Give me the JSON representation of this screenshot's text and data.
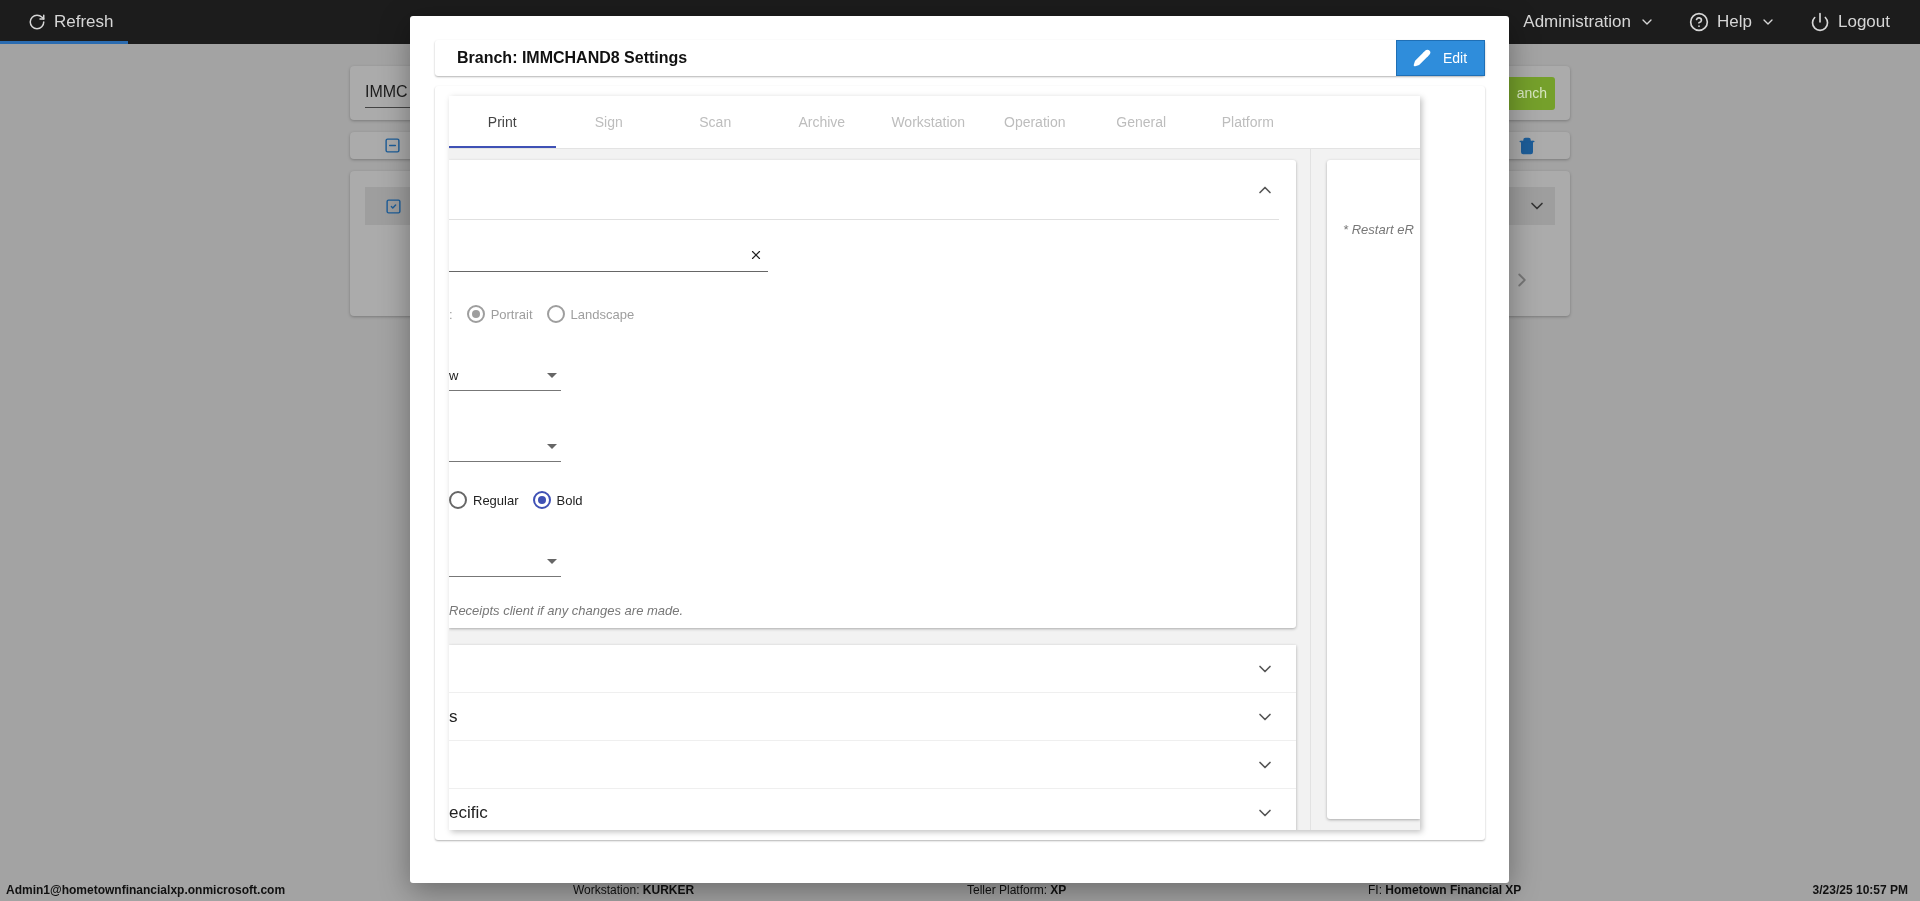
{
  "top_bar": {
    "refresh": {
      "label": "Refresh",
      "selected": true
    },
    "menus": [
      {
        "label": "Administration",
        "dropdown": true
      },
      {
        "label": "Help",
        "dropdown": true
      },
      {
        "label": "Logout",
        "dropdown": false
      }
    ]
  },
  "background": {
    "search_value": "IMMC",
    "action_button": "anch",
    "select_all_partial": true,
    "row_checked": true
  },
  "modal": {
    "title": "Branch: IMMCHAND8 Settings",
    "edit_button": "Edit",
    "tabs": [
      {
        "label": "Print",
        "selected": true
      },
      {
        "label": "Sign",
        "selected": false
      },
      {
        "label": "Scan",
        "selected": false
      },
      {
        "label": "Archive",
        "selected": false
      },
      {
        "label": "Workstation",
        "selected": false
      },
      {
        "label": "Operation",
        "selected": false
      },
      {
        "label": "General",
        "selected": false
      },
      {
        "label": "Platform",
        "selected": false
      }
    ],
    "section_expanded": true,
    "fields": [
      {
        "kind": "text"
      },
      {
        "kind": "radio",
        "label": ":",
        "disabled": true,
        "options": [
          {
            "label": "Portrait",
            "selected": true
          },
          {
            "label": "Landscape",
            "selected": false
          }
        ]
      },
      {
        "kind": "select",
        "value": "w"
      },
      {
        "kind": "select"
      },
      {
        "kind": "radio",
        "disabled": false,
        "options": [
          {
            "label": "Regular",
            "selected": false
          },
          {
            "label": "Bold",
            "selected": true
          }
        ]
      },
      {
        "kind": "select"
      },
      {
        "kind": "note",
        "text": "Receipts client if any changes are made."
      }
    ],
    "accordions": [
      {
        "expanded": false
      },
      {
        "title": "s",
        "expanded": false
      },
      {
        "expanded": false
      },
      {
        "title": "ecific",
        "expanded": false
      }
    ],
    "side_note": "* Restart eR"
  },
  "status_bar": {
    "user": "Admin1@hometownfinancialxp.onmicrosoft.com",
    "fields": [
      "Workstation: **KURKER**",
      "Teller Platform: **XP**",
      "FI: **Hometown Financial XP**"
    ],
    "time": "3/23/25 10:57 PM"
  }
}
